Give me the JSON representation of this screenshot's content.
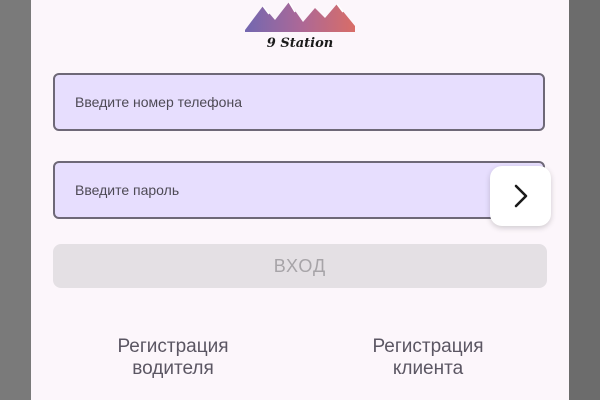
{
  "logo": {
    "text": "9 Station"
  },
  "form": {
    "phone_placeholder": "Введите номер телефона",
    "password_placeholder": "Введите пароль",
    "login_label": "ВХОД"
  },
  "links": {
    "driver_line1": "Регистрация",
    "driver_line2": "водителя",
    "client_line1": "Регистрация",
    "client_line2": "клиента"
  },
  "icons": {
    "next": "chevron-right-icon",
    "logo": "mountains-icon"
  },
  "colors": {
    "screen_bg": "#fcf6fb",
    "field_bg": "#e7defe",
    "button_disabled_bg": "#e4e0e4",
    "link_text": "#5b5663"
  }
}
